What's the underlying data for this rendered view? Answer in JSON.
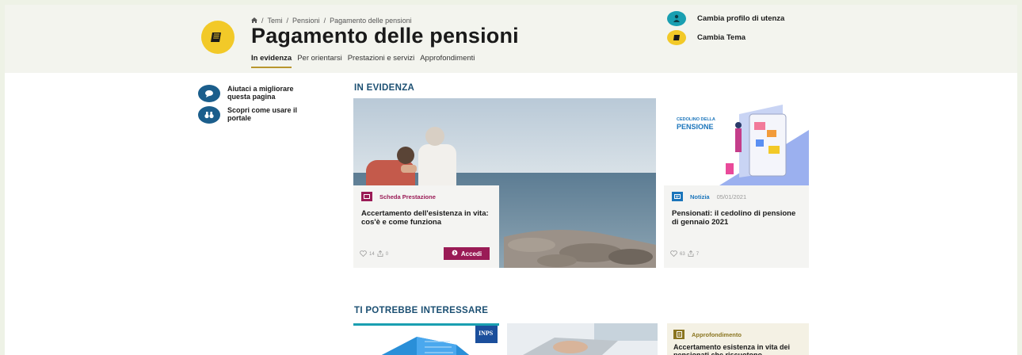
{
  "header": {
    "breadcrumb": [
      "Temi",
      "Pensioni",
      "Pagamento delle pensioni"
    ],
    "title": "Pagamento delle pensioni",
    "tabs": [
      "In evidenza",
      "Per orientarsi",
      "Prestazioni e servizi",
      "Approfondimenti"
    ],
    "actions": {
      "profile": "Cambia profilo di utenza",
      "theme": "Cambia Tema"
    }
  },
  "sidebar": {
    "items": [
      {
        "label": "Aiutaci a migliorare questa pagina",
        "icon": "chat-icon"
      },
      {
        "label": "Scopri come usare il portale",
        "icon": "binoculars-icon"
      }
    ]
  },
  "main": {
    "section_in_evidenza": "IN EVIDENZA",
    "featured": {
      "type": "Scheda Prestazione",
      "title": "Accertamento dell'esistenza in vita: cos'è e come funziona",
      "likes": "14",
      "shares": "0",
      "button": "Accedi"
    },
    "news": {
      "image_caption_line1": "CEDOLINO DELLA",
      "image_caption_line2": "PENSIONE",
      "type": "Notizia",
      "date": "05/01/2021",
      "title": "Pensionati: il cedolino di pensione di gennaio 2021",
      "likes": "63",
      "shares": "7"
    },
    "section_interessare": "TI POTREBBE INTERESSARE",
    "inps_logo": "INPS",
    "approfondimento": {
      "type": "Approfondimento",
      "title": "Accertamento esistenza in vita dei pensionati che riscuotono"
    }
  },
  "colors": {
    "accent_yellow": "#f2c928",
    "accent_teal": "#1a9fb1",
    "section_blue": "#1b4f72",
    "scheda_magenta": "#9a1b56",
    "notizia_blue": "#1b75bb",
    "approfondimento_olive": "#8a7520"
  }
}
